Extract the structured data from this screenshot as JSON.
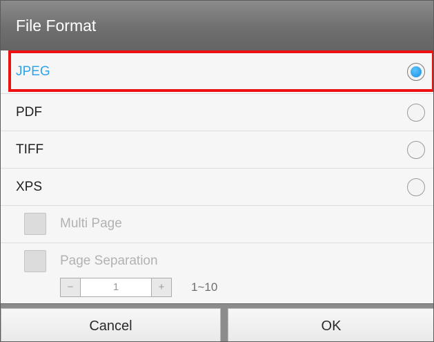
{
  "dialog": {
    "title": "File Format"
  },
  "options": [
    {
      "label": "JPEG",
      "selected": true
    },
    {
      "label": "PDF",
      "selected": false
    },
    {
      "label": "TIFF",
      "selected": false
    },
    {
      "label": "XPS",
      "selected": false
    }
  ],
  "multi_page": {
    "label": "Multi Page",
    "checked": false,
    "enabled": false
  },
  "page_separation": {
    "label": "Page Separation",
    "checked": false,
    "enabled": false,
    "stepper": {
      "minus": "−",
      "value": "1",
      "plus": "+",
      "range": "1~10"
    }
  },
  "buttons": {
    "cancel": "Cancel",
    "ok": "OK"
  },
  "colors": {
    "selected_text": "#2ea3e8",
    "highlight_border": "#ee1111",
    "header_bg": "#6f6f6f",
    "radio_fill": "#1a8fe0"
  }
}
